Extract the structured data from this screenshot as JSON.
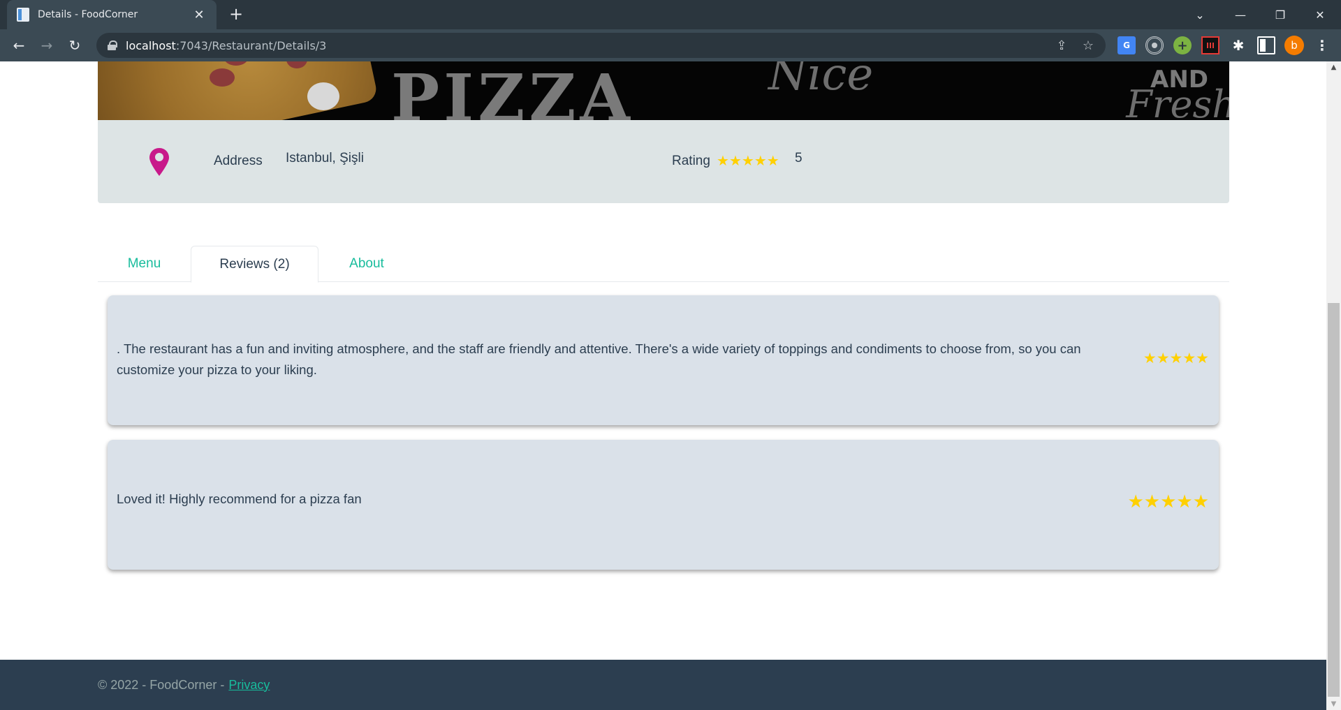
{
  "browser": {
    "tab_title": "Details - FoodCorner",
    "tab_close": "✕",
    "new_tab": "+",
    "url_host": "localhost",
    "url_path": ":7043/Restaurant/Details/3",
    "window_controls": {
      "dropdown": "⌄",
      "minimize": "—",
      "restore": "❐",
      "close": "✕"
    },
    "nav": {
      "back": "←",
      "forward": "→",
      "reload": "↻"
    },
    "avatar_letter": "b",
    "extensions": [
      "google-translate",
      "target",
      "plus",
      "stats",
      "puzzle",
      "side-panel"
    ]
  },
  "hero": {
    "title": "PIZZA",
    "script_text": "Nice",
    "tagline_and": "AND",
    "tagline_fresh": "Fresh"
  },
  "restaurant": {
    "address_label": "Address",
    "address_value": "Istanbul, Şişli",
    "rating_label": "Rating",
    "rating_value": "5",
    "rating_stars": 5,
    "colors": {
      "pin": "#c8198a",
      "star": "#ffd000",
      "accent": "#18bc9c"
    }
  },
  "tabs": [
    {
      "label": "Menu",
      "active": false
    },
    {
      "label": "Reviews (2)",
      "active": true
    },
    {
      "label": "About",
      "active": false
    }
  ],
  "reviews": [
    {
      "text": ". The restaurant has a fun and inviting atmosphere, and the staff are friendly and attentive. There's a wide variety of toppings and condiments to choose from, so you can customize your pizza to your liking.",
      "stars": 5
    },
    {
      "text": "Loved it! Highly recommend for a pizza fan",
      "stars": 5
    }
  ],
  "footer": {
    "copyright": "© 2022 - FoodCorner -",
    "privacy_link": "Privacy"
  },
  "scrollbar": {
    "up": "▲",
    "down": "▼"
  }
}
